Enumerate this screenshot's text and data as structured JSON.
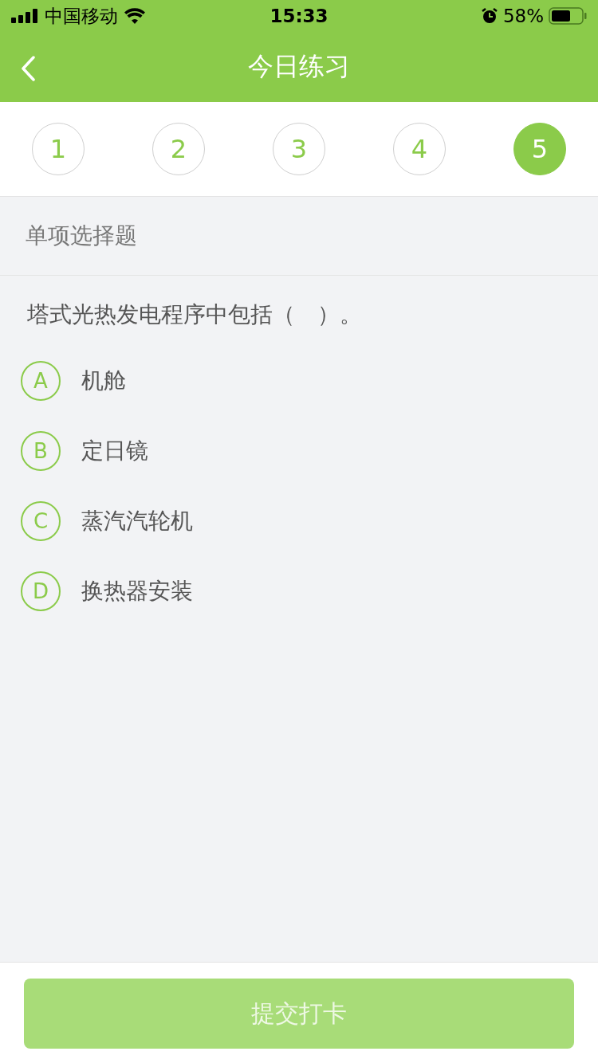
{
  "status_bar": {
    "carrier": "中国移动",
    "time": "15:33",
    "battery": "58%"
  },
  "nav": {
    "title": "今日练习"
  },
  "steps": [
    {
      "label": "1",
      "selected": false
    },
    {
      "label": "2",
      "selected": false
    },
    {
      "label": "3",
      "selected": false
    },
    {
      "label": "4",
      "selected": false
    },
    {
      "label": "5",
      "selected": true
    }
  ],
  "question": {
    "type": "单项选择题",
    "text": "塔式光热发电程序中包括（　）。",
    "options": [
      {
        "letter": "A",
        "text": "机舱",
        "selected": false
      },
      {
        "letter": "B",
        "text": "定日镜",
        "selected": false
      },
      {
        "letter": "C",
        "text": "蒸汽汽轮机",
        "selected": false
      },
      {
        "letter": "D",
        "text": "换热器安装",
        "selected": false
      }
    ]
  },
  "submit": {
    "label": "提交打卡",
    "disabled": true
  }
}
